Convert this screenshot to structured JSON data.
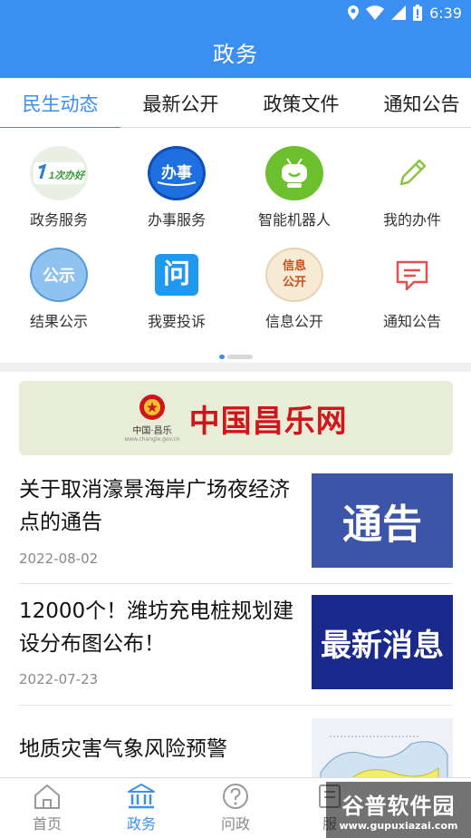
{
  "status_bar": {
    "time": "6:39"
  },
  "header": {
    "title": "政务"
  },
  "tabs": [
    {
      "label": "民生动态",
      "active": true
    },
    {
      "label": "最新公开",
      "active": false
    },
    {
      "label": "政策文件",
      "active": false
    },
    {
      "label": "通知公告",
      "active": false
    }
  ],
  "services": [
    {
      "label": "政务服务",
      "icon": "yicibanhao-logo-icon",
      "logo_text": "1次办好"
    },
    {
      "label": "办事服务",
      "icon": "banshi-icon",
      "logo_text": "办事"
    },
    {
      "label": "智能机器人",
      "icon": "robot-icon"
    },
    {
      "label": "我的办件",
      "icon": "pencil-icon"
    },
    {
      "label": "结果公示",
      "icon": "gongshi-icon",
      "logo_text": "公示"
    },
    {
      "label": "我要投诉",
      "icon": "complaint-icon",
      "logo_text": "问"
    },
    {
      "label": "信息公开",
      "icon": "xinxi-icon",
      "logo_text": "信息公开"
    },
    {
      "label": "通知公告",
      "icon": "message-icon"
    }
  ],
  "banner": {
    "title": "中国昌乐网",
    "emblem_caption": "中国·昌乐",
    "url": "www.changle.gov.cn"
  },
  "news": [
    {
      "title": "关于取消濠景海岸广场夜经济点的通告",
      "date": "2022-08-02",
      "thumb_text": "通告",
      "thumb_color": "#3d55a8"
    },
    {
      "title": "12000个！潍坊充电桩规划建设分布图公布！",
      "date": "2022-07-23",
      "thumb_text": "最新消息",
      "thumb_color": "#1a2a8c"
    },
    {
      "title": "地质灾害气象风险预警",
      "date": "",
      "thumb_text": "",
      "thumb_color": "#e8edf4"
    }
  ],
  "bottom_nav": [
    {
      "label": "首页",
      "icon": "home-icon",
      "active": false
    },
    {
      "label": "政务",
      "icon": "government-building-icon",
      "active": true
    },
    {
      "label": "问政",
      "icon": "question-circle-icon",
      "active": false
    },
    {
      "label": "服",
      "icon": "service-icon",
      "active": false
    }
  ],
  "watermark": {
    "text": "谷普软件园",
    "url": "www.gupuxiazai.com"
  },
  "colors": {
    "accent": "#3b8ff0",
    "banner_red": "#d2141b"
  }
}
